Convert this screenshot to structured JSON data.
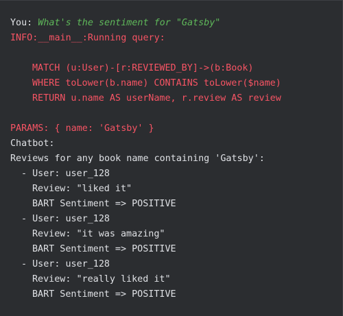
{
  "console": {
    "prompt_label": "You: ",
    "prompt_text": "What's the sentiment for \"Gatsby\"",
    "info_line": "INFO:__main__:Running query:",
    "query_lines": [
      "MATCH (u:User)-[r:REVIEWED_BY]->(b:Book)",
      "WHERE toLower(b.name) CONTAINS toLower($name)",
      "RETURN u.name AS userName, r.review AS review"
    ],
    "params_line": "PARAMS: { name: 'Gatsby' }",
    "chatbot_label": "Chatbot:",
    "reviews_header": "Reviews for any book name containing 'Gatsby':",
    "reviews": [
      {
        "user": "- User: user_128",
        "review": "Review: \"liked it\"",
        "sentiment": "BART Sentiment => POSITIVE"
      },
      {
        "user": "- User: user_128",
        "review": "Review: \"it was amazing\"",
        "sentiment": "BART Sentiment => POSITIVE"
      },
      {
        "user": "- User: user_128",
        "review": "Review: \"really liked it\"",
        "sentiment": "BART Sentiment => POSITIVE"
      }
    ]
  },
  "colors": {
    "background": "#2b2d30",
    "text": "#dfe1e5",
    "log_red": "#f75464",
    "input_green": "#5fb85a"
  }
}
